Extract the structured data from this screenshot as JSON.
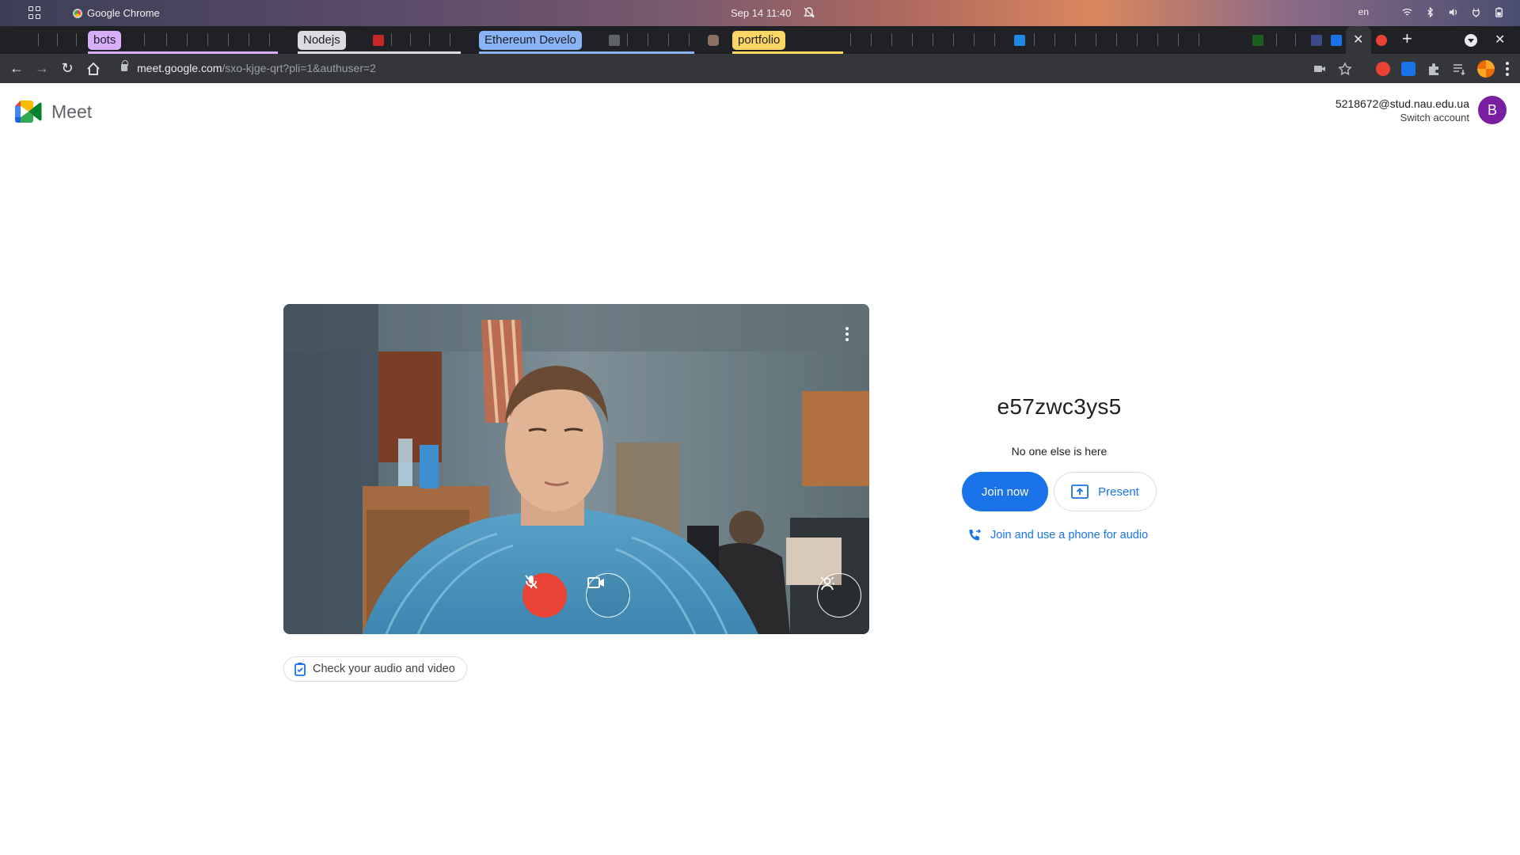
{
  "os_bar": {
    "app_name": "Google Chrome",
    "clock": "Sep 14  11:40",
    "lang": "en"
  },
  "tabs": {
    "groups": [
      {
        "label": "bots",
        "color": "#d7aefb"
      },
      {
        "label": "Nodejs",
        "color": "#dadce0"
      },
      {
        "label": "Ethereum Develo",
        "color": "#8ab4f8"
      },
      {
        "label": "portfolio",
        "color": "#fdd663"
      }
    ]
  },
  "toolbar": {
    "url_host": "meet.google.com",
    "url_path": "/sxo-kjge-qrt?pli=1&authuser=2"
  },
  "header": {
    "product": "Meet",
    "account_email": "5218672@stud.nau.edu.ua",
    "switch_account": "Switch account",
    "avatar_letter": "B",
    "avatar_color": "#7b1fa2"
  },
  "preview": {
    "check_label": "Check your audio and video"
  },
  "join_panel": {
    "meeting_code": "e57zwc3ys5",
    "status": "No one else is here",
    "join_label": "Join now",
    "present_label": "Present",
    "phone_label": "Join and use a phone for audio",
    "accent": "#1a73e8"
  }
}
